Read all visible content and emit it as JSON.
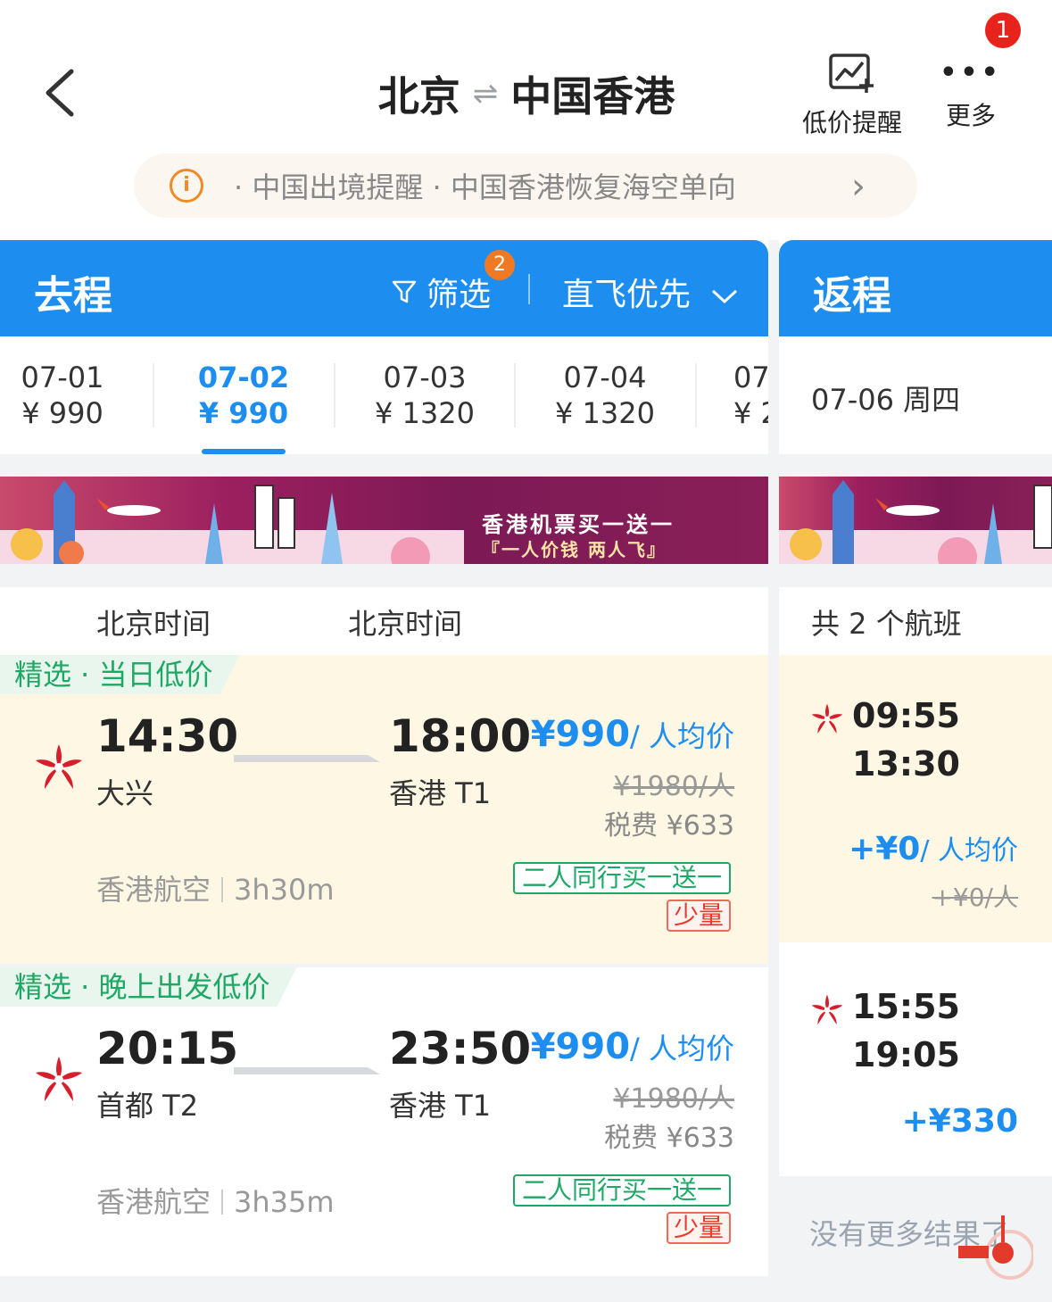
{
  "header": {
    "from_city": "北京",
    "to_city": "中国香港",
    "price_alert_label": "低价提醒",
    "more_label": "更多",
    "more_badge": "1"
  },
  "notice": {
    "text": "· 中国出境提醒 · 中国香港恢复海空单向"
  },
  "outbound": {
    "label": "去程",
    "filter_label": "筛选",
    "filter_badge": "2",
    "sort_label": "直飞优先",
    "dates": [
      {
        "date": "07-01",
        "price": "¥ 990"
      },
      {
        "date": "07-02",
        "price": "¥ 990"
      },
      {
        "date": "07-03",
        "price": "¥ 1320"
      },
      {
        "date": "07-04",
        "price": "¥ 1320"
      },
      {
        "date": "07",
        "price": "¥ 2"
      }
    ],
    "col_dep": "北京时间",
    "col_arr": "北京时间",
    "banner_title": "香港机票买一送一",
    "banner_sub": "『一人价钱 两人飞』",
    "flights": [
      {
        "tag": "精选 · 当日低价",
        "dep_time": "14:30",
        "dep_airport": "大兴",
        "arr_time": "18:00",
        "arr_airport": "香港 T1",
        "price": "¥990",
        "price_unit": "/ 人均价",
        "orig_price": "¥1980/人",
        "tax": "税费 ¥633",
        "airline": "香港航空",
        "duration": "3h30m",
        "promo": "二人同行买一送一",
        "stock": "少量"
      },
      {
        "tag": "精选 · 晚上出发低价",
        "dep_time": "20:15",
        "dep_airport": "首都 T2",
        "arr_time": "23:50",
        "arr_airport": "香港 T1",
        "price": "¥990",
        "price_unit": "/ 人均价",
        "orig_price": "¥1980/人",
        "tax": "税费 ¥633",
        "airline": "香港航空",
        "duration": "3h35m",
        "promo": "二人同行买一送一",
        "stock": "少量"
      }
    ]
  },
  "return": {
    "label": "返程",
    "date": "07-06 周四",
    "count": "共 2 个航班",
    "flights": [
      {
        "dep_time": "09:55",
        "arr_time": "13:30",
        "price": "+¥0",
        "price_unit": "/ 人均价",
        "orig_price": "+¥0/人"
      },
      {
        "dep_time": "15:55",
        "arr_time": "19:05",
        "price": "+¥330"
      }
    ],
    "no_more": "没有更多结果了"
  },
  "colors": {
    "primary": "#1d8ef0",
    "green": "#1da866",
    "red": "#e63b2c",
    "highlight_bg": "#fdf7e3"
  }
}
